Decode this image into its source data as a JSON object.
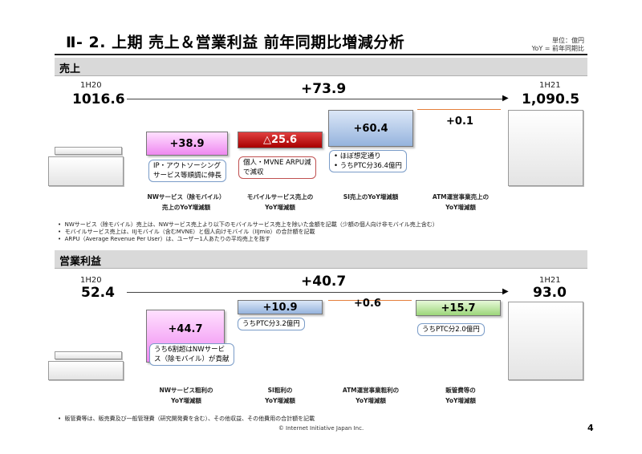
{
  "page": {
    "title": "Ⅱ- 2.  上期 売上＆営業利益  前年同期比増減分析",
    "unit_line1": "単位：億円",
    "unit_line2": "YoY = 前年同期比",
    "footer": "© Internet Initiative Japan Inc.",
    "page_number": "4"
  },
  "sales": {
    "section_label": "売上",
    "start_period": "1H20",
    "start_value_text": "1016.6",
    "end_period": "1H21",
    "end_value_text": "1,090.5",
    "total_delta_text": "+73.9",
    "items": [
      {
        "value_text": "+38.9",
        "callout": [
          "IP・アウトソーシング",
          "サービス等順調に伸長"
        ],
        "category": [
          "NWサービス（除モバイル）",
          "売上のYoY増減額"
        ]
      },
      {
        "value_text": "△25.6",
        "callout": [
          "個人・MVNE ARPU減",
          "で減収"
        ],
        "category": [
          "モバイルサービス売上の",
          "YoY増減額"
        ]
      },
      {
        "value_text": "+60.4",
        "callout": [
          "• ほぼ想定通り",
          "• うちPTC分36.4億円"
        ],
        "category": [
          "SI売上のYoY増減額"
        ]
      },
      {
        "value_text": "+0.1",
        "callout": [],
        "category": [
          "ATM運営事業売上の",
          "YoY増減額"
        ]
      }
    ],
    "notes": [
      "NWサービス（除モバイル）売上は、NWサービス売上より以下のモバイルサービス売上を除いた金額を記載（少額の個人向け非モバイル売上含む）",
      "モバイルサービス売上は、IIJモバイル（含むMVNE）と個人向けモバイル（IIJmio）の合計額を記載",
      "ARPU（Average Revenue Per User）は、ユーザー1人あたりの平均売上を指す"
    ]
  },
  "op": {
    "section_label": "営業利益",
    "start_period": "1H20",
    "start_value_text": "52.4",
    "end_period": "1H21",
    "end_value_text": "93.0",
    "total_delta_text": "+40.7",
    "items": [
      {
        "value_text": "+44.7",
        "callout": [
          "うち6割超はNWサービ",
          "ス（除モバイル）が貢献"
        ],
        "category": [
          "NWサービス粗利の",
          "YoY増減額"
        ]
      },
      {
        "value_text": "+10.9",
        "callout": [
          "うちPTC分3.2億円"
        ],
        "category": [
          "SI粗利の",
          "YoY増減額"
        ]
      },
      {
        "value_text": "+0.6",
        "callout": [],
        "category": [
          "ATM運営事業粗利の",
          "YoY増減額"
        ]
      },
      {
        "value_text": "+15.7",
        "callout": [
          "うちPTC分2.0億円"
        ],
        "category": [
          "販管費等の",
          "YoY増減額"
        ]
      }
    ],
    "notes": [
      "販管費等は、販売費及び一般管理費（研究開発費を含む）、その他収益、その他費用の合計額を記載"
    ]
  },
  "chart_data": [
    {
      "type": "bar",
      "subtype": "waterfall",
      "title": "売上",
      "categories": [
        "1H20",
        "NWサービス（除モバイル）売上のYoY増減額",
        "モバイルサービス売上のYoY増減額",
        "SI売上のYoY増減額",
        "ATM運営事業売上のYoY増減額",
        "1H21"
      ],
      "values": [
        1016.6,
        38.9,
        -25.6,
        60.4,
        0.1,
        1090.5
      ],
      "total_change": 73.9,
      "colors": [
        "#e8e8e8",
        "#ee88f0",
        "#c00000",
        "#95b3dd",
        "#e5803c",
        "#e8e8e8"
      ]
    },
    {
      "type": "bar",
      "subtype": "waterfall",
      "title": "営業利益",
      "categories": [
        "1H20",
        "NWサービス粗利のYoY増減額",
        "SI粗利のYoY増減額",
        "ATM運営事業粗利のYoY増減額",
        "販管費等のYoY増減額",
        "1H21"
      ],
      "values": [
        52.4,
        44.7,
        10.9,
        0.6,
        15.7,
        93.0
      ],
      "total_change": 40.7,
      "colors": [
        "#e8e8e8",
        "#ee88f0",
        "#95b3dd",
        "#e5803c",
        "#9cd67a",
        "#e8e8e8"
      ]
    }
  ]
}
